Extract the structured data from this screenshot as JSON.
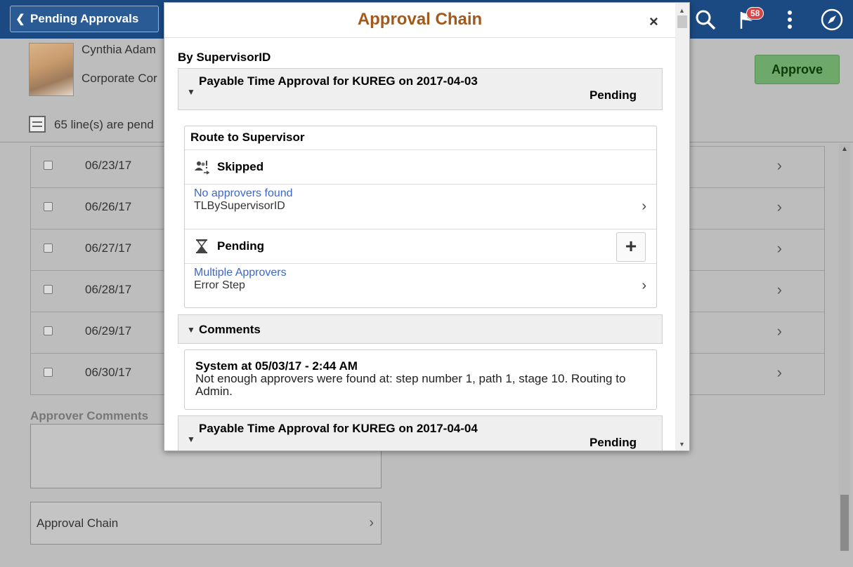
{
  "header": {
    "back_label": "Pending Approvals",
    "notification_count": "58"
  },
  "profile": {
    "name": "Cynthia Adam",
    "department": "Corporate Cor"
  },
  "approve_button": "Approve",
  "lines_pending": "65 line(s) are pend",
  "rows": [
    {
      "date": "06/23/17"
    },
    {
      "date": "06/26/17"
    },
    {
      "date": "06/27/17"
    },
    {
      "date": "06/28/17"
    },
    {
      "date": "06/29/17"
    },
    {
      "date": "06/30/17"
    }
  ],
  "approver_comments_label": "Approver Comments",
  "approval_chain_link": "Approval Chain",
  "modal": {
    "title": "Approval Chain",
    "close": "×",
    "group_label": "By SupervisorID",
    "approvals": [
      {
        "title": "Payable Time Approval for KUREG on 2017-04-03",
        "status": "Pending"
      },
      {
        "title": "Payable Time Approval for KUREG on 2017-04-04",
        "status": "Pending"
      }
    ],
    "route": {
      "title": "Route to Supervisor",
      "steps": [
        {
          "status": "Skipped",
          "link": "No approvers found",
          "detail": "TLBySupervisorID"
        },
        {
          "status": "Pending",
          "link": "Multiple Approvers",
          "detail": "Error Step"
        }
      ]
    },
    "comments": {
      "label": "Comments",
      "author": "System at 05/03/17 - 2:44 AM",
      "text": "Not enough approvers were found at: step number 1, path 1, stage 10. Routing to Admin."
    }
  }
}
